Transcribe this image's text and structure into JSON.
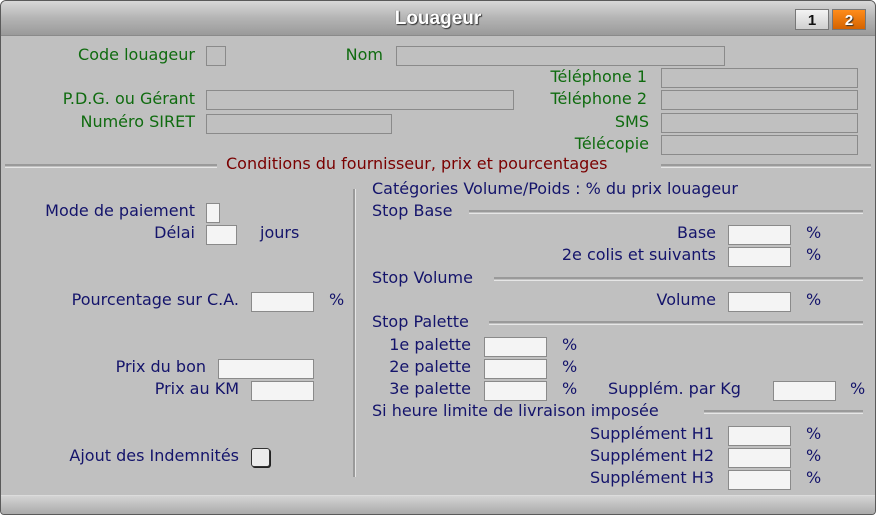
{
  "window": {
    "title": "Louageur",
    "pages": [
      {
        "label": "1",
        "active": false
      },
      {
        "label": "2",
        "active": true
      }
    ],
    "active_page_color": "#e07000"
  },
  "header": {
    "code_label": "Code louageur",
    "code_value": "",
    "nom_label": "Nom",
    "nom_value": "",
    "pdg_label": "P.D.G. ou Gérant",
    "pdg_value": "",
    "siret_label": "Numéro SIRET",
    "siret_value": "",
    "tel1_label": "Téléphone 1",
    "tel1_value": "",
    "tel2_label": "Téléphone 2",
    "tel2_value": "",
    "sms_label": "SMS",
    "sms_value": "",
    "fax_label": "Télécopie",
    "fax_value": ""
  },
  "section_title": "Conditions du fournisseur, prix et pourcentages",
  "left": {
    "mode_paiement_label": "Mode de paiement",
    "mode_paiement_value": "",
    "delai_label": "Délai",
    "delai_value": "",
    "delai_unit": "jours",
    "pourcentage_ca_label": "Pourcentage sur C.A.",
    "pourcentage_ca_value": "",
    "pourcentage_ca_unit": "%",
    "prix_bon_label": "Prix du bon",
    "prix_bon_value": "",
    "prix_km_label": "Prix au KM",
    "prix_km_value": "",
    "indemnites_label": "Ajout des Indemnités",
    "indemnites_checked": false
  },
  "right": {
    "heading": "Catégories Volume/Poids : % du prix louageur",
    "stop_base_title": "Stop Base",
    "base_label": "Base",
    "base_value": "",
    "colis_label": "2e colis et suivants",
    "colis_value": "",
    "stop_volume_title": "Stop Volume",
    "volume_label": "Volume",
    "volume_value": "",
    "stop_palette_title": "Stop Palette",
    "palette1_label": "1e palette",
    "palette1_value": "",
    "palette2_label": "2e palette",
    "palette2_value": "",
    "palette3_label": "3e palette",
    "palette3_value": "",
    "supplem_kg_label": "Supplém. par Kg",
    "supplem_kg_value": "",
    "heure_title": "Si heure limite de livraison imposée",
    "h1_label": "Supplément H1",
    "h1_value": "",
    "h2_label": "Supplément H2",
    "h2_value": "",
    "h3_label": "Supplément H3",
    "h3_value": "",
    "percent": "%"
  }
}
